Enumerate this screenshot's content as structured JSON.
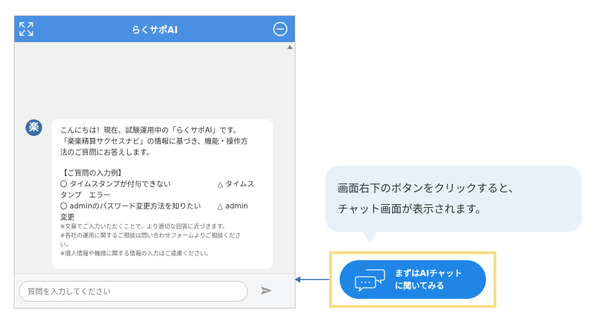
{
  "chat": {
    "title": "らくサポAI",
    "avatar_text": "楽",
    "message": {
      "intro": [
        "こんにちは！現在、試験運用中の「らくサポAI」です。",
        "「楽楽精算サクセスナビ」の情報に基づき、機能・操作方",
        "法のご質問にお答えします。"
      ],
      "examples_heading": "【ご質問の入力例】",
      "example_rows": [
        {
          "left": "〇 タイムスタンプが付与できない",
          "right": "△ タイムス"
        },
        {
          "left": "タンプ　エラー",
          "right": ""
        },
        {
          "left": "〇 adminのパスワード変更方法を知りたい",
          "right": "△ admin"
        },
        {
          "left": "変更",
          "right": ""
        }
      ],
      "notes": [
        "※文章でご入力いただくことで、より適切な回答に近づきます。",
        "※各社の運用に関するご相談は問い合わせフォームよりご相談くださ",
        "い。",
        "※個人情報や機微に関する情報の入力はご遠慮ください。"
      ]
    },
    "input": {
      "placeholder": "質問を入力してください",
      "value": ""
    }
  },
  "callout": {
    "lines": [
      "画面右下のボタンをクリックすると、",
      "チャット画面が表示されます。"
    ]
  },
  "launcher": {
    "lines": [
      "まずはAIチャット",
      "に聞いてみる"
    ]
  },
  "icons": {
    "expand": "expand-icon",
    "minimize": "minimize-icon",
    "send": "send-icon",
    "chat-bubbles": "chat-bubbles-icon",
    "pointer": "arrow-left-icon"
  },
  "colors": {
    "header": "#4a90e2",
    "launcher": "#1f86e6",
    "highlight": "#f6de86",
    "callout": "#e8f1f9",
    "avatar": "#3a6ea5"
  }
}
